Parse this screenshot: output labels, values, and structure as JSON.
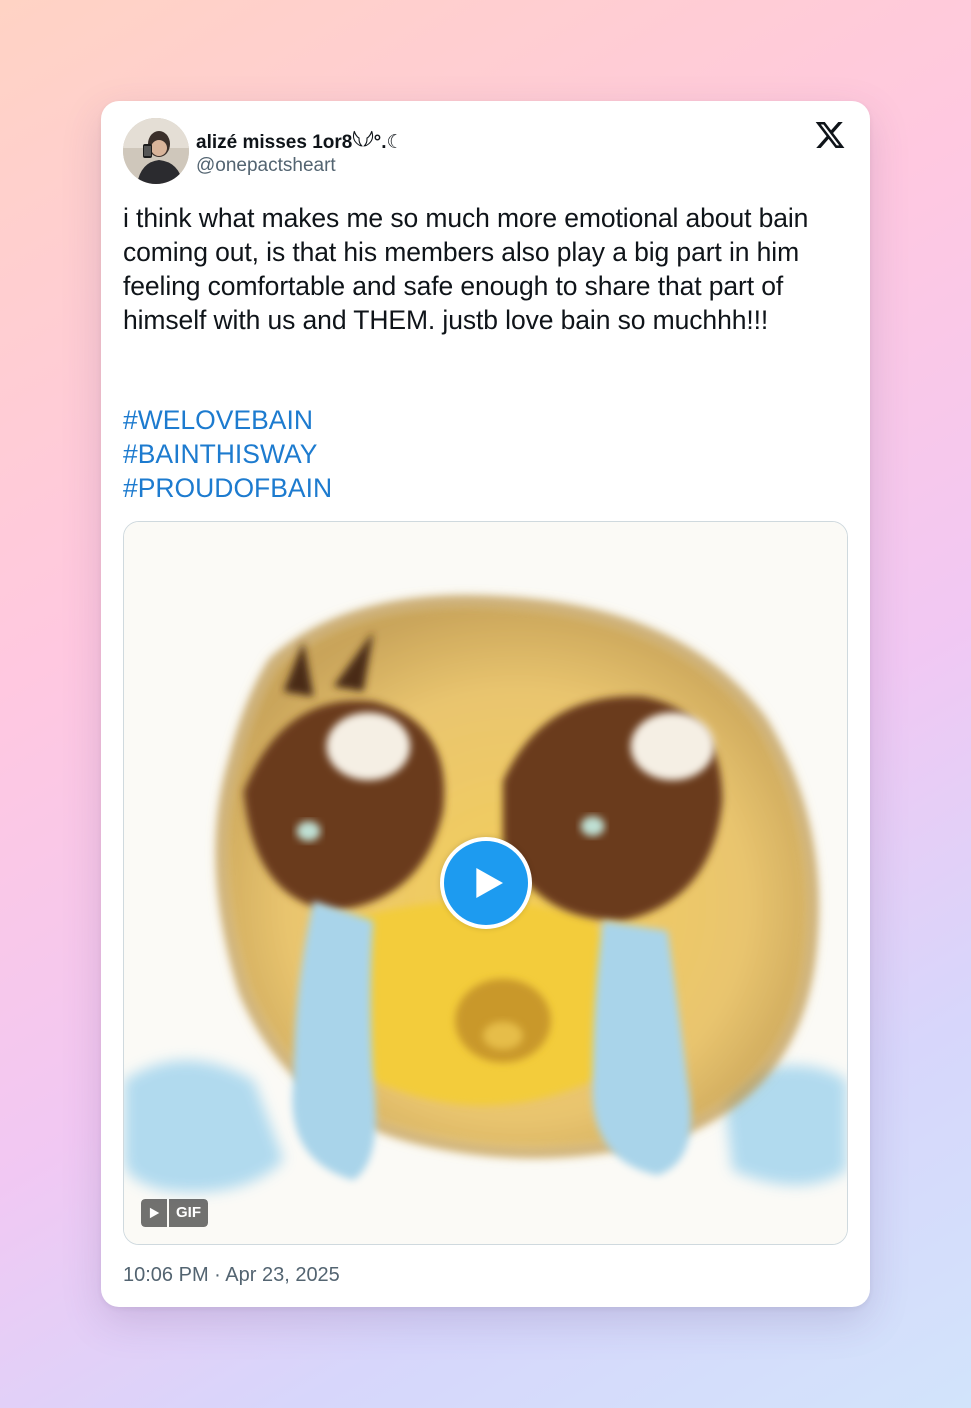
{
  "tweet": {
    "display_name": "alizé misses 1or8𓆩𓆪°.☾",
    "handle": "@onepactsheart",
    "text": "i think what makes me so much more emotional about bain coming out, is that his members also play a big part in him feeling comfortable and safe enough to share that part of himself with us and THEM. justb love bain so muchhh!!!",
    "hashtags": [
      "#WELOVEBAIN",
      "#BAINTHISWAY",
      "#PROUDOFBAIN"
    ],
    "timestamp": "10:06 PM · Apr 23, 2025",
    "media": {
      "badge_label": "GIF",
      "subject": "crying pleading face emoji"
    }
  },
  "icons": {
    "brand": "x-logo-icon",
    "play": "play-icon"
  },
  "colors": {
    "link": "#1d7bcf",
    "play_button": "#1d9bf0",
    "text": "#0f1419",
    "secondary_text": "#536471"
  }
}
